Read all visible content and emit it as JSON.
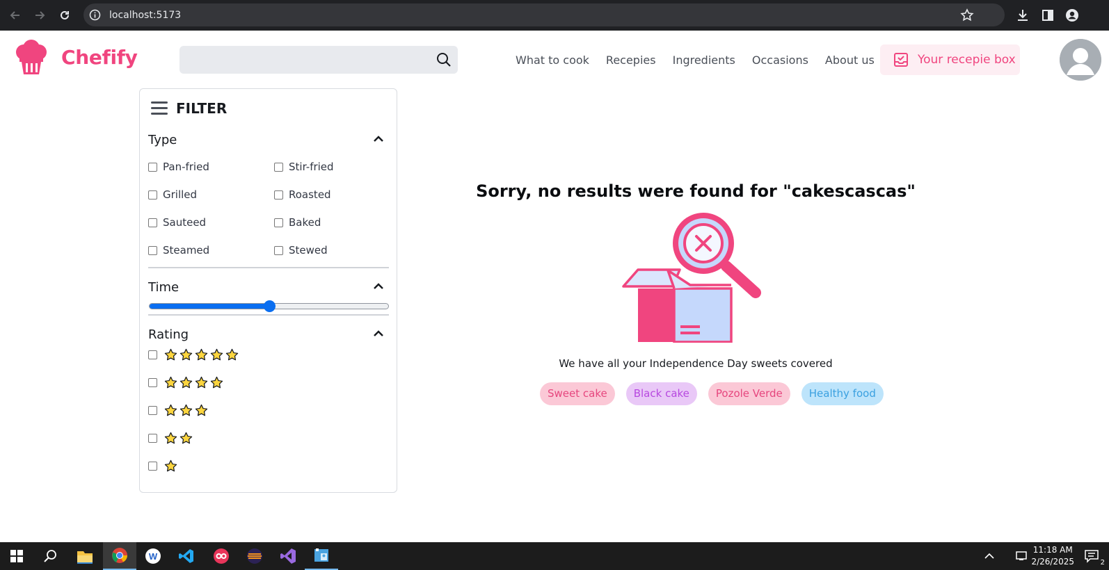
{
  "browser": {
    "url": "localhost:5173"
  },
  "header": {
    "brand": "Chefify",
    "search": {
      "value": "",
      "placeholder": ""
    },
    "nav": [
      "What to cook",
      "Recepies",
      "Ingredients",
      "Occasions",
      "About us"
    ],
    "recipe_box_label": "Your recepie box",
    "accent": "#f0457f"
  },
  "filter": {
    "title": "FILTER",
    "type_section": {
      "title": "Type",
      "options": [
        {
          "label": "Pan-fried",
          "checked": false
        },
        {
          "label": "Stir-fried",
          "checked": false
        },
        {
          "label": "Grilled",
          "checked": false
        },
        {
          "label": "Roasted",
          "checked": false
        },
        {
          "label": "Sauteed",
          "checked": false
        },
        {
          "label": "Baked",
          "checked": false
        },
        {
          "label": "Steamed",
          "checked": false
        },
        {
          "label": "Stewed",
          "checked": false
        }
      ]
    },
    "time_section": {
      "title": "Time",
      "slider_value_fraction": 0.5
    },
    "rating_section": {
      "title": "Rating",
      "options": [
        {
          "stars": 5,
          "checked": false
        },
        {
          "stars": 4,
          "checked": false
        },
        {
          "stars": 3,
          "checked": false
        },
        {
          "stars": 2,
          "checked": false
        },
        {
          "stars": 1,
          "checked": false
        }
      ]
    }
  },
  "results": {
    "empty_title": "Sorry, no results were found for \"cakescascas\"",
    "subtitle": "We have all your Independence Day sweets covered",
    "tags": [
      {
        "label": "Sweet cake",
        "bg": "#fbc8d6",
        "color": "#e6467e"
      },
      {
        "label": "Black cake",
        "bg": "#e9c8f7",
        "color": "#b748e0"
      },
      {
        "label": "Pozole Verde",
        "bg": "#fbc8d6",
        "color": "#e6467e"
      },
      {
        "label": "Healthy food",
        "bg": "#bde4fb",
        "color": "#3aa0e0"
      }
    ]
  },
  "taskbar": {
    "time": "11:18 AM",
    "date": "2/26/2025",
    "notification_count": "2"
  }
}
